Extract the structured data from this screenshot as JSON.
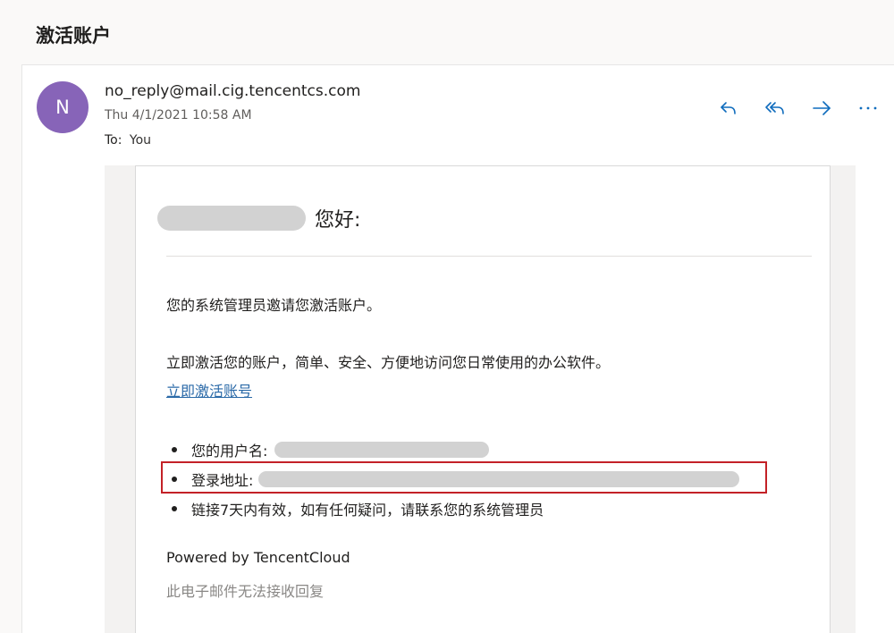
{
  "subject": "激活账户",
  "message": {
    "avatar_initial": "N",
    "sender": "no_reply@mail.cig.tencentcs.com",
    "date": "Thu 4/1/2021 10:58 AM",
    "to_label": "To:",
    "to_value": "You",
    "actions": [
      {
        "name": "reply",
        "icon": "reply-icon"
      },
      {
        "name": "reply-all",
        "icon": "reply-all-icon"
      },
      {
        "name": "forward",
        "icon": "forward-icon"
      },
      {
        "name": "more",
        "icon": "more-icon"
      }
    ]
  },
  "email": {
    "greeting_suffix": "您好:",
    "para1": "您的系统管理员邀请您激活账户。",
    "para2": "立即激活您的账户，简单、安全、方便地访问您日常使用的办公软件。",
    "activate_link": "立即激活账号",
    "bullets": {
      "username_label": "您的用户名:",
      "login_label": "登录地址:",
      "validity": "链接7天内有效，如有任何疑问，请联系您的系统管理员"
    },
    "powered_by": "Powered by TencentCloud",
    "no_reply_note": "此电子邮件无法接收回复"
  },
  "colors": {
    "avatar": "#8764b8",
    "action_icon": "#0f6cbd",
    "link": "#2b6aa8",
    "highlight_border": "#c32127"
  }
}
